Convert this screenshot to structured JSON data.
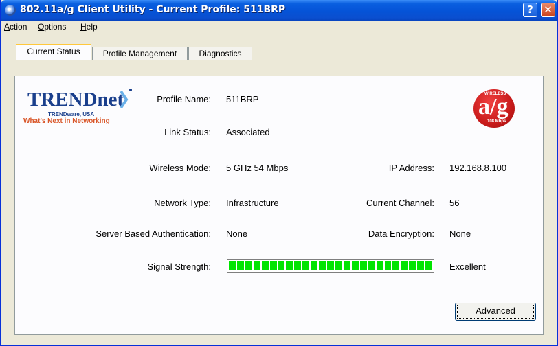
{
  "window": {
    "title": "802.11a/g Client Utility - Current Profile: 511BRP"
  },
  "menu": [
    {
      "label": "Action",
      "underline": "A"
    },
    {
      "label": "Options",
      "underline": "O"
    },
    {
      "label": "Help",
      "underline": "H"
    }
  ],
  "tabs": [
    {
      "label": "Current Status",
      "active": true
    },
    {
      "label": "Profile Management",
      "active": false
    },
    {
      "label": "Diagnostics",
      "active": false
    }
  ],
  "logo": {
    "brand": "TRENDnet",
    "sub1": "TRENDware, USA",
    "sub2": "What's Next in Networking"
  },
  "badge": {
    "text": "a/g",
    "top": "WIRELESS",
    "bottom": "108 Mbps"
  },
  "status": {
    "profile_name_label": "Profile Name:",
    "profile_name": "511BRP",
    "link_status_label": "Link Status:",
    "link_status": "Associated",
    "wireless_mode_label": "Wireless Mode:",
    "wireless_mode": "5 GHz 54 Mbps",
    "ip_address_label": "IP Address:",
    "ip_address": "192.168.8.100",
    "network_type_label": "Network Type:",
    "network_type": "Infrastructure",
    "current_channel_label": "Current Channel:",
    "current_channel": "56",
    "server_auth_label": "Server Based Authentication:",
    "server_auth": "None",
    "data_encryption_label": "Data Encryption:",
    "data_encryption": "None",
    "signal_strength_label": "Signal Strength:",
    "signal_strength_value": "Excellent",
    "signal_level": 1.0,
    "signal_color": "#00e400"
  },
  "buttons": {
    "advanced": "Advanced"
  },
  "icons": [
    "app-icon",
    "help-icon",
    "close-icon"
  ]
}
